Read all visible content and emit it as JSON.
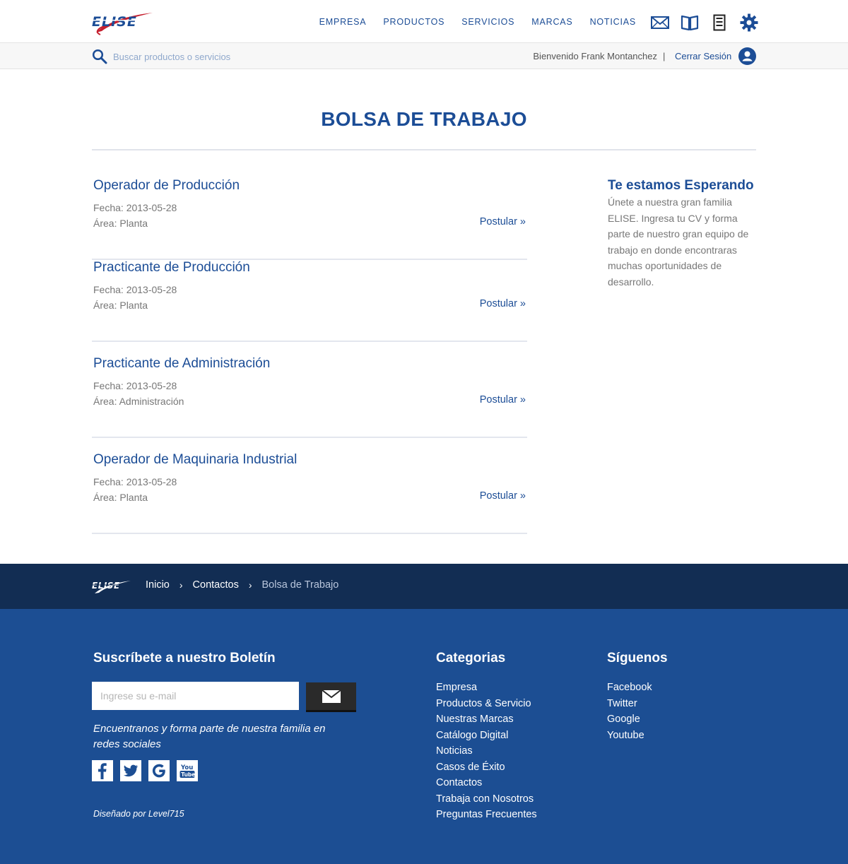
{
  "brand": {
    "primary": "#1c4d96",
    "dark": "#122d53",
    "footer": "#1c4e93",
    "logo_red": "#c6202f"
  },
  "header": {
    "nav": [
      "EMPRESA",
      "PRODUCTOS",
      "SERVICIOS",
      "MARCAS",
      "NOTICIAS"
    ],
    "icons": [
      "mail-icon",
      "catalog-book-icon",
      "document-icon",
      "gear-icon"
    ]
  },
  "search": {
    "placeholder": "Buscar productos o servicios"
  },
  "session": {
    "welcome": "Bienvenido Frank Montanchez",
    "separator": "|",
    "logout": "Cerrar Sesión"
  },
  "page": {
    "title": "BOLSA DE TRABAJO"
  },
  "jobs": [
    {
      "title": "Operador de Producción",
      "date": "Fecha: 2013-05-28",
      "area": "Área: Planta",
      "apply": "Postular »"
    },
    {
      "title": "Practicante de Producción",
      "date": "Fecha: 2013-05-28",
      "area": "Área: Planta",
      "apply": "Postular »"
    },
    {
      "title": "Practicante de Administración",
      "date": "Fecha: 2013-05-28",
      "area": "Área: Administración",
      "apply": "Postular »"
    },
    {
      "title": "Operador de Maquinaria Industrial",
      "date": "Fecha: 2013-05-28",
      "area": "Área: Planta",
      "apply": "Postular »"
    }
  ],
  "aside": {
    "title": "Te estamos Esperando",
    "text": "Únete a nuestra gran familia ELISE. Ingresa tu CV y forma parte de nuestro gran equipo de trabajo en donde encontraras muchas oportunidades de desarrollo."
  },
  "breadcrumb": {
    "items": [
      "Inicio",
      "Contactos"
    ],
    "current": "Bolsa de Trabajo",
    "arrow": "›"
  },
  "footer": {
    "newsletter_title": "Suscríbete a nuestro Boletín",
    "email_placeholder": "Ingrese su e-mail",
    "find_us": "Encuentranos y forma parte de nuestra familia en redes sociales",
    "socials": [
      "facebook-icon",
      "twitter-icon",
      "google-icon",
      "youtube-icon"
    ],
    "designed_by": "Diseñado por Level715",
    "categories_title": "Categorias",
    "categories": [
      "Empresa",
      "Productos & Servicio",
      "Nuestras Marcas",
      "Catálogo Digital",
      "Noticias",
      "Casos de Éxito",
      "Contactos",
      "Trabaja con Nosotros",
      "Preguntas Frecuentes"
    ],
    "follow_title": "Síguenos",
    "follow": [
      "Facebook",
      "Twitter",
      "Google",
      "Youtube"
    ]
  }
}
